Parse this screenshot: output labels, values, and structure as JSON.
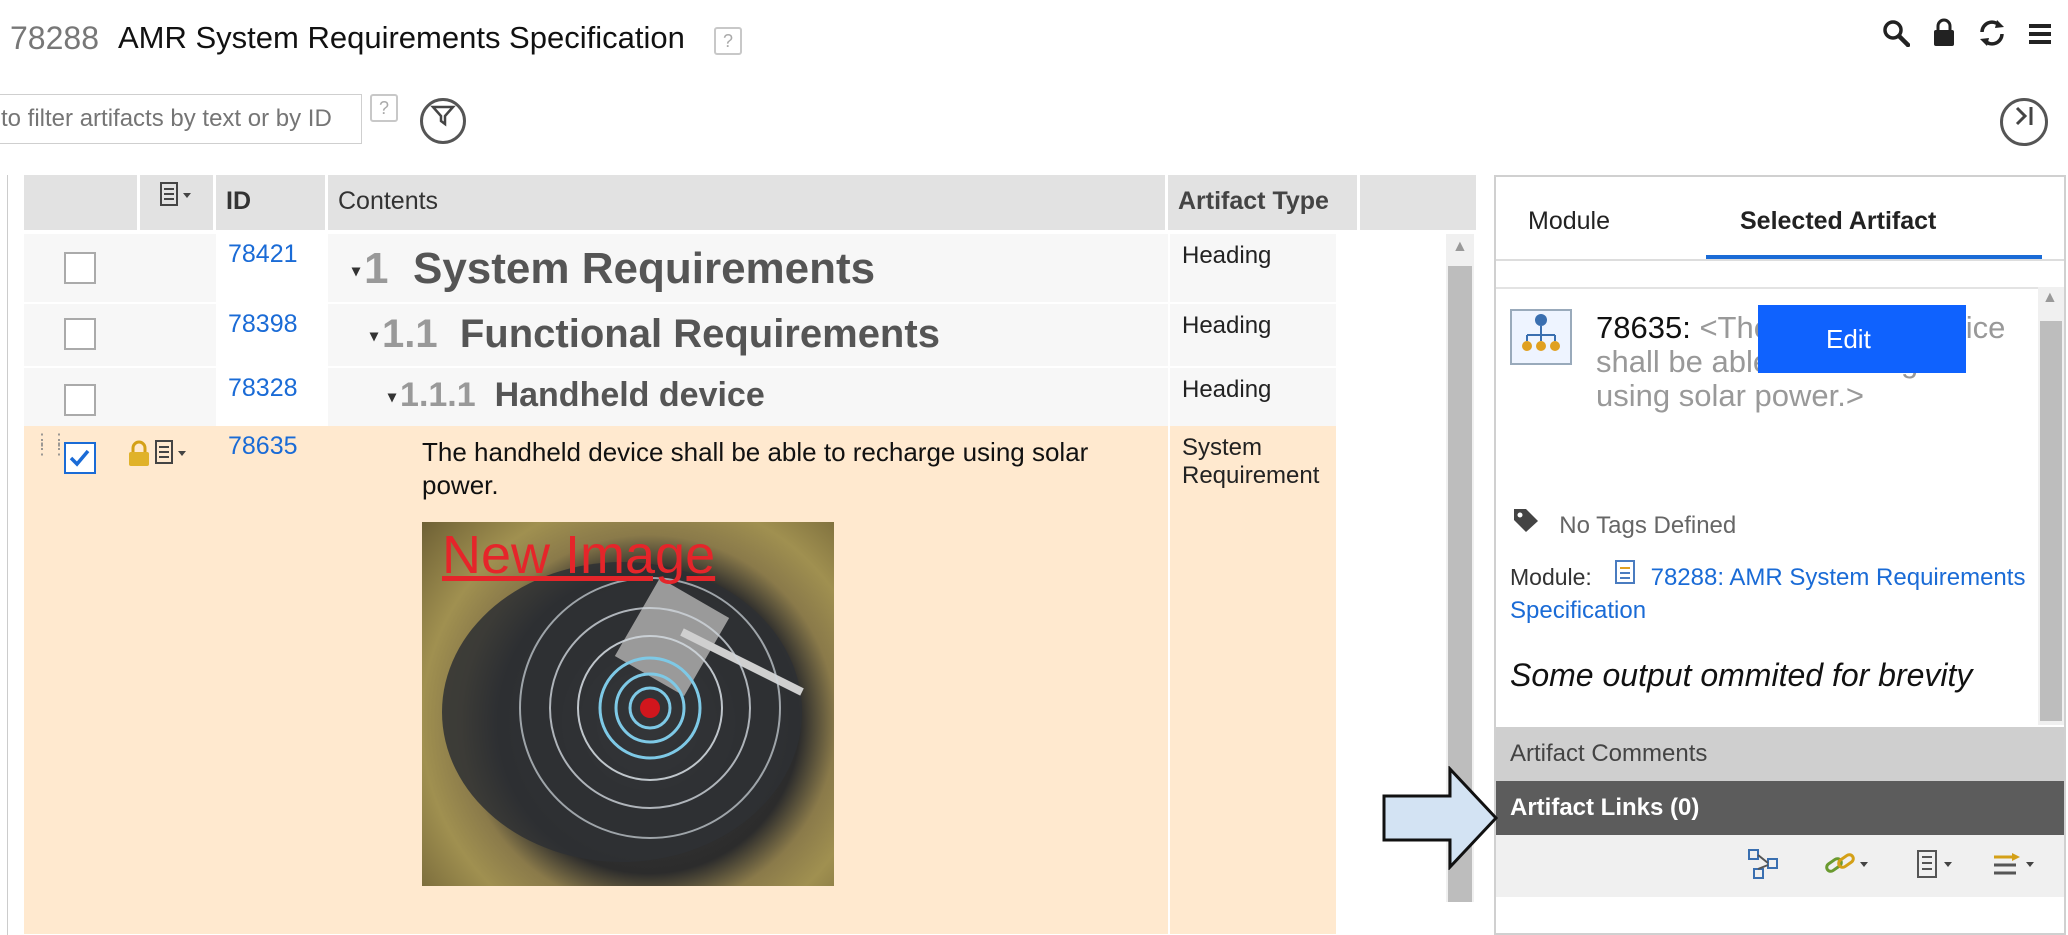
{
  "header": {
    "module_id": "78288",
    "module_title": "AMR System Requirements Specification",
    "help_glyph": "?",
    "icons": [
      "search-icon",
      "lock-icon",
      "refresh-icon",
      "menu-icon"
    ]
  },
  "filter": {
    "placeholder": "to filter artifacts by text or by ID",
    "help_glyph": "?"
  },
  "grid": {
    "columns": {
      "id": "ID",
      "contents": "Contents",
      "artifact_type": "Artifact Type"
    },
    "rows": [
      {
        "id": "78421",
        "number": "1",
        "title": "System Requirements",
        "type": "Heading"
      },
      {
        "id": "78398",
        "number": "1.1",
        "title": "Functional Requirements",
        "type": "Heading"
      },
      {
        "id": "78328",
        "number": "1.1.1",
        "title": "Handheld device",
        "type": "Heading"
      },
      {
        "id": "78635",
        "text": "The handheld device shall be able to recharge using solar power.",
        "type": "System Requirement",
        "image_caption": "New Image",
        "selected": true,
        "locked": true
      }
    ]
  },
  "panel": {
    "tabs": [
      "Module",
      "Selected Artifact"
    ],
    "active_tab": "Selected Artifact",
    "artifact": {
      "id": "78635:",
      "summary": "<The handheld device shall be able to recharge using solar power.>",
      "edit_label": "Edit"
    },
    "tags": "No Tags Defined",
    "module_label": "Module:",
    "module_link": "78288: AMR System Requirements Specification",
    "omitted_note": "Some output ommited for brevity",
    "comments_label": "Artifact Comments",
    "links_label": "Artifact Links (0)"
  },
  "colors": {
    "selected_row": "#ffe9cf",
    "link": "#1a6bd6",
    "edit_button": "#0f62fe",
    "links_bar": "#5c5c5c",
    "new_image_text": "#e5252a",
    "arrow_fill": "#d3e3f3"
  }
}
